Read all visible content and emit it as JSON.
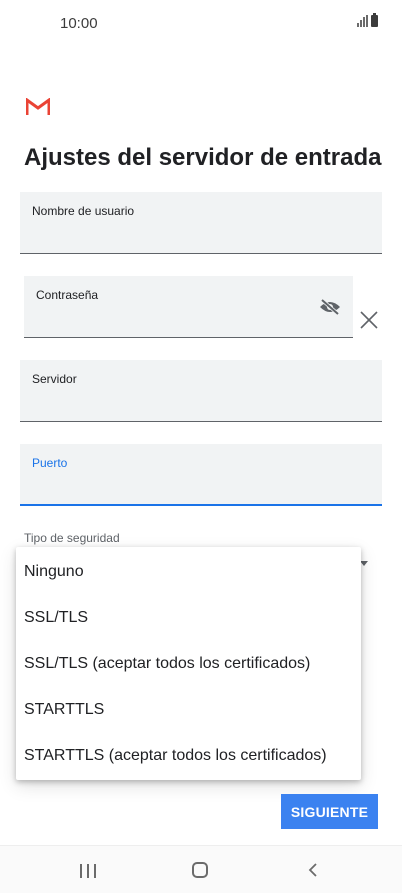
{
  "status_bar": {
    "time": "10:00"
  },
  "app": {
    "logo_icon": "gmail-icon",
    "brand_color": "#ea4335",
    "accent_color": "#1a73e8"
  },
  "page": {
    "title": "Ajustes del servidor de entrada"
  },
  "fields": {
    "username": {
      "label": "Nombre de usuario",
      "value": ""
    },
    "password": {
      "label": "Contraseña",
      "value": "",
      "toggle_icon": "eye-off-icon",
      "clear_icon": "close-icon"
    },
    "server": {
      "label": "Servidor",
      "value": ""
    },
    "port": {
      "label": "Puerto",
      "value": ""
    }
  },
  "security": {
    "label": "Tipo de seguridad",
    "options": [
      "Ninguno",
      "SSL/TLS",
      "SSL/TLS (aceptar todos los certificados)",
      "STARTTLS",
      "STARTTLS (aceptar todos los certificados)"
    ]
  },
  "actions": {
    "next_label": "SIGUIENTE",
    "next_color": "#3b82f0"
  },
  "nav": {
    "recent_icon": "recent-apps-icon",
    "home_icon": "home-icon",
    "back_icon": "back-icon"
  }
}
